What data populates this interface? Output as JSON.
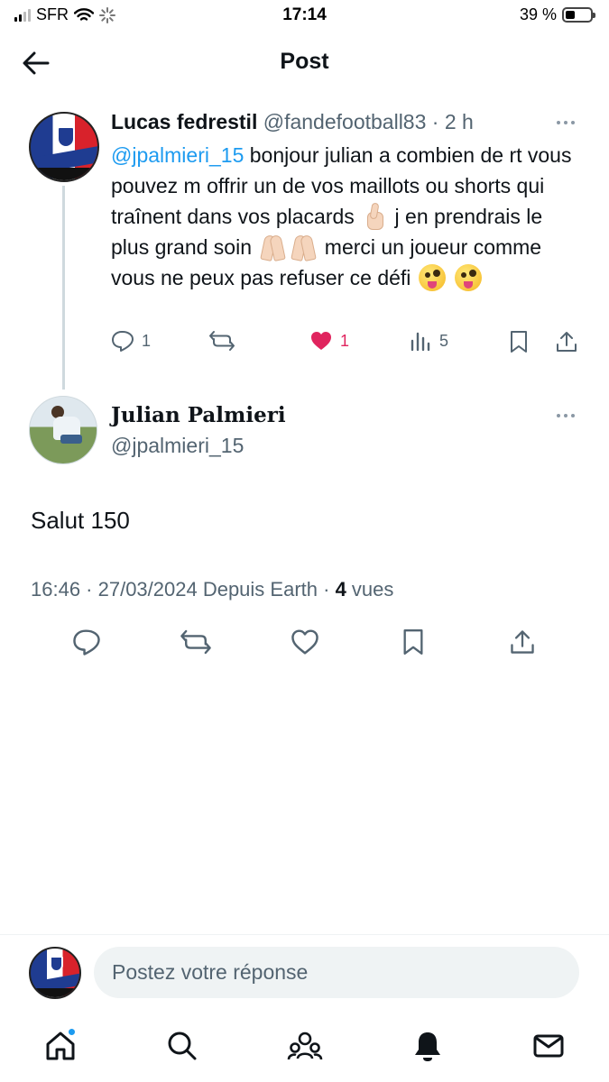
{
  "status_bar": {
    "carrier": "SFR",
    "time": "17:14",
    "battery_percent": "39 %",
    "battery_level": 0.39,
    "icons": [
      "signal-icon",
      "wifi-icon",
      "loading-icon",
      "battery-icon"
    ]
  },
  "header": {
    "title": "Post",
    "back_icon": "arrow-left-icon"
  },
  "parent_tweet": {
    "display_name": "Lucas fedrestil",
    "meta": "@fandefootball83 · 2 h",
    "mention": "@jpalmieri_15",
    "text_part1": " bonjour julian a combien de rt vous pouvez m offrir un de vos maillots ou shorts qui traînent dans vos placards ",
    "text_part2": " j en prendrais le plus grand soin ",
    "text_part3": " merci un joueur comme vous ne peux pas refuser ce défi ",
    "reply_count": "1",
    "like_count": "1",
    "view_count": "5",
    "like_color": "#e0245e"
  },
  "main_tweet": {
    "display_name": "Julian Palmieri",
    "handle": "@jpalmieri_15",
    "text": "Salut 150",
    "timestamp": "16:46 · 27/03/2024 Depuis Earth · ",
    "views_count": "4",
    "views_label": " vues"
  },
  "composer": {
    "placeholder": "Postez votre réponse"
  },
  "bottom_nav": {
    "items": [
      "home-icon",
      "search-icon",
      "communities-icon",
      "notifications-icon",
      "messages-icon"
    ],
    "badge_color": "#1d9bf0"
  },
  "colors": {
    "accent": "#1d9bf0",
    "text": "#0f1419",
    "secondary": "#536471"
  }
}
